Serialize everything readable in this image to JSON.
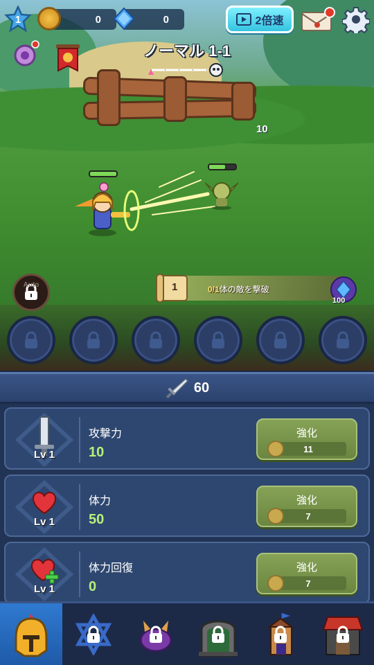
{
  "hud": {
    "player_level": "1",
    "gold": "0",
    "gems": "0",
    "speed_button": "2倍速",
    "mail_has_notification": true,
    "settings_icon": "gear-icon"
  },
  "stage": {
    "title": "ノーマル 1-1",
    "progress_fraction": 0.85
  },
  "battle": {
    "damage_number": "10",
    "hero_hp": 1.0,
    "enemy_hp": 0.6,
    "auto_label": "Auto"
  },
  "quest": {
    "number": "1",
    "progress": "0/1",
    "text": "体の敵を撃破",
    "reward": "100"
  },
  "skill_slots": [
    "locked",
    "locked",
    "locked",
    "locked",
    "locked",
    "locked"
  ],
  "power": {
    "value": "60"
  },
  "upgrades": [
    {
      "name": "攻撃力",
      "level": "Lv 1",
      "value": "10",
      "button": "強化",
      "cost": "11",
      "icon": "sword-icon"
    },
    {
      "name": "体力",
      "level": "Lv 1",
      "value": "50",
      "button": "強化",
      "cost": "7",
      "icon": "heart-icon"
    },
    {
      "name": "体力回復",
      "level": "Lv 1",
      "value": "0",
      "button": "強化",
      "cost": "7",
      "icon": "heart-plus-icon"
    }
  ],
  "nav": [
    {
      "name": "hero",
      "icon": "helmet-icon",
      "active": true,
      "locked": false
    },
    {
      "name": "skills",
      "icon": "star-emblem-icon",
      "active": false,
      "locked": true
    },
    {
      "name": "pets",
      "icon": "paw-icon",
      "active": false,
      "locked": true
    },
    {
      "name": "dungeon",
      "icon": "gate-icon",
      "active": false,
      "locked": true
    },
    {
      "name": "tower",
      "icon": "tower-icon",
      "active": false,
      "locked": true
    },
    {
      "name": "shop",
      "icon": "shop-icon",
      "active": false,
      "locked": true
    }
  ],
  "colors": {
    "accent_cyan": "#35c4e0",
    "panel_bg": "#223455",
    "upgrade_green": "#6a8640",
    "value_green": "#b6f07a",
    "hp_green": "#7ed957"
  }
}
